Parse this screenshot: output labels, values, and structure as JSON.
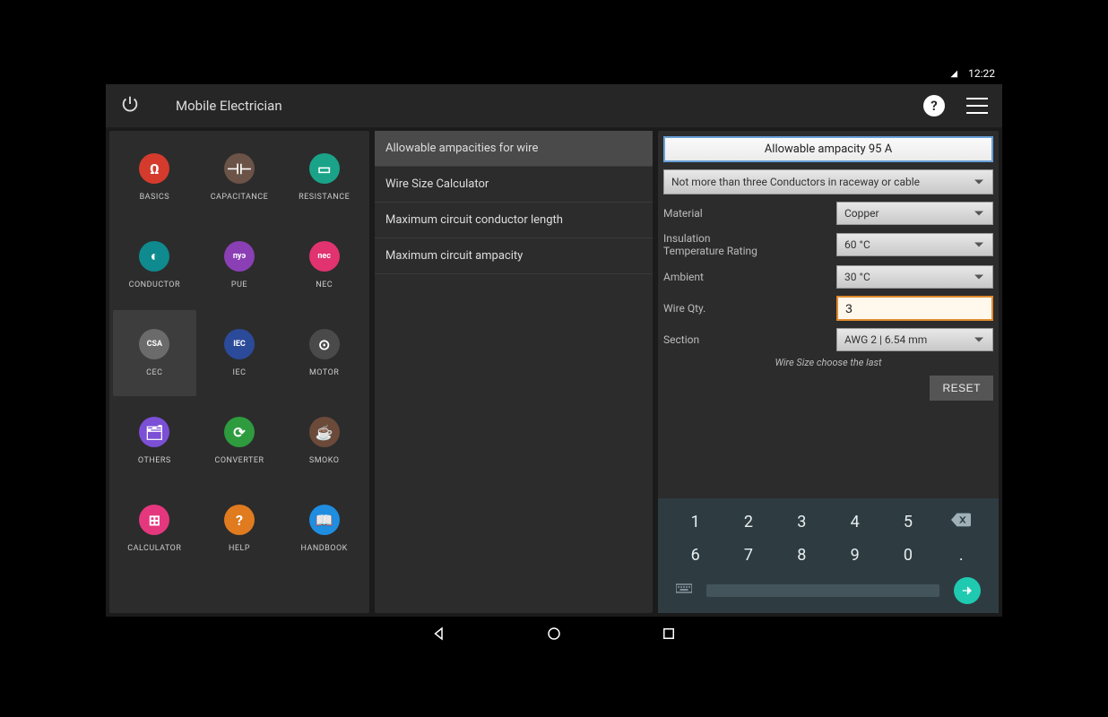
{
  "status": {
    "time": "12:22"
  },
  "header": {
    "title": "Mobile Electrician"
  },
  "categories": [
    {
      "id": "basics",
      "label": "BASICS",
      "color": "#d43b2d",
      "glyph": "Ω"
    },
    {
      "id": "capacitance",
      "label": "CAPACITANCE",
      "color": "#6b5347",
      "glyph": "⊣⊢"
    },
    {
      "id": "resistance",
      "label": "RESISTANCE",
      "color": "#1aa389",
      "glyph": "▭"
    },
    {
      "id": "conductor",
      "label": "CONDUCTOR",
      "color": "#0f8a8f",
      "glyph": "◐"
    },
    {
      "id": "pue",
      "label": "PUE",
      "color": "#8b3fb5",
      "glyph": "пуэ"
    },
    {
      "id": "nec",
      "label": "NEC",
      "color": "#e0336f",
      "glyph": "nec"
    },
    {
      "id": "cec",
      "label": "CEC",
      "color": "#6b6b6b",
      "glyph": "CSA"
    },
    {
      "id": "iec",
      "label": "IEC",
      "color": "#2b4a99",
      "glyph": "IEC"
    },
    {
      "id": "motor",
      "label": "MOTOR",
      "color": "#4a4a4a",
      "glyph": "⊙"
    },
    {
      "id": "others",
      "label": "OTHERS",
      "color": "#7b4fd6",
      "glyph": "🗂"
    },
    {
      "id": "converter",
      "label": "CONVERTER",
      "color": "#2e9b3f",
      "glyph": "⟳"
    },
    {
      "id": "smoko",
      "label": "SMOKO",
      "color": "#6b4a3a",
      "glyph": "☕"
    },
    {
      "id": "calculator",
      "label": "CALCULATOR",
      "color": "#e5377e",
      "glyph": "⊞"
    },
    {
      "id": "help",
      "label": "HELP",
      "color": "#e07b1f",
      "glyph": "?"
    },
    {
      "id": "handbook",
      "label": "HANDBOOK",
      "color": "#1f8de0",
      "glyph": "📖"
    }
  ],
  "selected_category": "cec",
  "menu_items": [
    "Allowable ampacities for wire",
    "Wire Size Calculator",
    "Maximum circuit conductor length",
    "Maximum circuit ampacity"
  ],
  "selected_menu_index": 0,
  "form": {
    "result": "Allowable ampacity 95 A",
    "conductors_select": "Not more than three Conductors in raceway or cable",
    "material": {
      "label": "Material",
      "value": "Copper"
    },
    "insulation": {
      "label": "Insulation\nTemperature Rating",
      "value": "60 °C"
    },
    "ambient": {
      "label": "Ambient",
      "value": "30 °C"
    },
    "wire_qty": {
      "label": "Wire Qty.",
      "value": "3"
    },
    "section": {
      "label": "Section",
      "value": "AWG 2 | 6.54 mm"
    },
    "hint": "Wire Size choose the last",
    "reset": "RESET"
  },
  "keypad": {
    "row1": [
      "1",
      "2",
      "3",
      "4",
      "5"
    ],
    "row2": [
      "6",
      "7",
      "8",
      "9",
      "0",
      "."
    ]
  }
}
